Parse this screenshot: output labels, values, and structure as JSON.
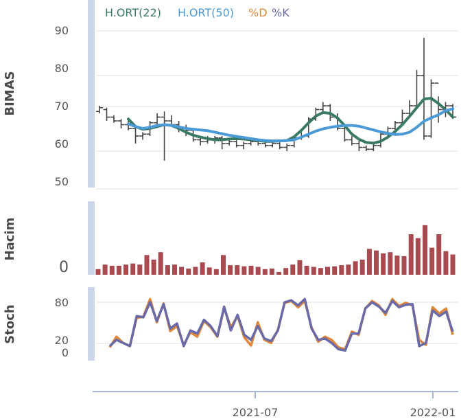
{
  "chart_data": [
    {
      "type": "line",
      "panel": "price",
      "ylabel": "BIMAS",
      "yticks": [
        50,
        60,
        70,
        80,
        90
      ],
      "ylim": [
        48,
        98
      ],
      "legend": [
        {
          "label": "H.ORT(22)",
          "color": "#3a7a64"
        },
        {
          "label": "H.ORT(50)",
          "color": "#4a9ad8"
        },
        {
          "label": "%D",
          "color": "#e0883a"
        },
        {
          "label": "%K",
          "color": "#6a6aa8"
        }
      ],
      "legend_position": "top-left",
      "ohlc_color": "#444444",
      "ohlc": [
        [
          68.5,
          70,
          68,
          69.5
        ],
        [
          69,
          69.5,
          66,
          67
        ],
        [
          67,
          67.5,
          65.5,
          66
        ],
        [
          66,
          66.5,
          64,
          65
        ],
        [
          65,
          66,
          63.5,
          64
        ],
        [
          64,
          64.5,
          60,
          62
        ],
        [
          62,
          63,
          61,
          62.5
        ],
        [
          62.5,
          66,
          62,
          65.5
        ],
        [
          65.5,
          68,
          65,
          67
        ],
        [
          67,
          68.5,
          55.5,
          66
        ],
        [
          66,
          67.5,
          64.5,
          65
        ],
        [
          65,
          66,
          63,
          64
        ],
        [
          64,
          65,
          62,
          63.5
        ],
        [
          63.5,
          64,
          60.5,
          61
        ],
        [
          61,
          62,
          59.5,
          60.5
        ],
        [
          60.5,
          62,
          60,
          61
        ],
        [
          61,
          62,
          60,
          61.5
        ],
        [
          61.5,
          62,
          58.5,
          60
        ],
        [
          60,
          61,
          59.5,
          60.5
        ],
        [
          60.5,
          61,
          59,
          59.5
        ],
        [
          59.5,
          60.5,
          58.5,
          60
        ],
        [
          60,
          61,
          59.5,
          60.5
        ],
        [
          60.5,
          61,
          59.5,
          60
        ],
        [
          60,
          60.5,
          59,
          59.5
        ],
        [
          59.5,
          60.5,
          59,
          60
        ],
        [
          60,
          60.5,
          58.5,
          59
        ],
        [
          59,
          60,
          58,
          59.5
        ],
        [
          59.5,
          62,
          59,
          61.5
        ],
        [
          61.5,
          63,
          61,
          62
        ],
        [
          62,
          67,
          61.5,
          66.5
        ],
        [
          66.5,
          69.5,
          66,
          69
        ],
        [
          69,
          71,
          68,
          70
        ],
        [
          70,
          70.5,
          66,
          67
        ],
        [
          67,
          68,
          63.5,
          64
        ],
        [
          64,
          65,
          60.5,
          61
        ],
        [
          61,
          62,
          59.5,
          60
        ],
        [
          60,
          61.5,
          58,
          59
        ],
        [
          59,
          59.5,
          58,
          58.5
        ],
        [
          58.5,
          60,
          58,
          59.5
        ],
        [
          59.5,
          63,
          59,
          62.5
        ],
        [
          62.5,
          64.5,
          62,
          64
        ],
        [
          64,
          66,
          63.5,
          65.5
        ],
        [
          65.5,
          69,
          65,
          68
        ],
        [
          68,
          71.5,
          67.5,
          70
        ],
        [
          70,
          79.5,
          69.5,
          78
        ],
        [
          78,
          88,
          61,
          62
        ],
        [
          62,
          77,
          61.5,
          76
        ],
        [
          76,
          72.5,
          65.5,
          69
        ],
        [
          69,
          71,
          67,
          70
        ],
        [
          70,
          70.5,
          66.5,
          67
        ]
      ],
      "series": [
        {
          "name": "H.ORT(22)",
          "color": "#3a7a64",
          "values": [
            null,
            null,
            null,
            null,
            66.5,
            64.5,
            63.8,
            64,
            64.5,
            65,
            64.8,
            64,
            63,
            62.2,
            61.7,
            61.3,
            61,
            61,
            61.2,
            61.3,
            61.2,
            61,
            60.8,
            60.6,
            60.6,
            60.7,
            60.8,
            61.8,
            63.5,
            65.5,
            67.3,
            68.2,
            68,
            66.8,
            64.8,
            62.5,
            61.1,
            60.3,
            60.1,
            60.6,
            61.7,
            63.2,
            65,
            67.2,
            69.5,
            71.8,
            72,
            70.6,
            69,
            67
          ]
        },
        {
          "name": "H.ORT(50)",
          "color": "#4a9ad8",
          "values": [
            null,
            null,
            null,
            null,
            65.2,
            64.5,
            64,
            64.3,
            64.8,
            65,
            64.8,
            64.4,
            64,
            63.8,
            63.6,
            63.4,
            63,
            62.6,
            62.2,
            61.9,
            61.6,
            61.3,
            61,
            60.8,
            60.7,
            60.7,
            60.8,
            61,
            61.7,
            62.5,
            63.3,
            63.9,
            64.3,
            64.6,
            64.8,
            64.8,
            64.6,
            64.1,
            63.6,
            63.1,
            62.7,
            62.4,
            62.5,
            63,
            64.3,
            65.9,
            66.8,
            67.6,
            68.7,
            69.2
          ]
        },
        {
          "name": "%D",
          "color": "#e0883a",
          "values": [
            8,
            25,
            15,
            10,
            55,
            57,
            85,
            48,
            78,
            34,
            42,
            12,
            32,
            25,
            50,
            40,
            25,
            71,
            40,
            58,
            24,
            11,
            48,
            20,
            15,
            36,
            79,
            82,
            72,
            82,
            40,
            17,
            25,
            20,
            8,
            5,
            33,
            28,
            70,
            82,
            75,
            60,
            85,
            74,
            79,
            75,
            20,
            12,
            72,
            62,
            70,
            28
          ]
        },
        {
          "name": "%K",
          "color": "#6a6aa8",
          "values": [
            10,
            20,
            15,
            10,
            58,
            56,
            80,
            50,
            77,
            38,
            46,
            10,
            35,
            30,
            52,
            42,
            26,
            73,
            35,
            60,
            28,
            20,
            42,
            22,
            18,
            35,
            80,
            83,
            75,
            85,
            38,
            20,
            22,
            15,
            5,
            3,
            30,
            30,
            70,
            80,
            73,
            63,
            82,
            72,
            76,
            77,
            10,
            15,
            67,
            58,
            65,
            33
          ]
        }
      ]
    },
    {
      "type": "bar",
      "panel": "volume",
      "ylabel": "Hacim",
      "yticks": [
        0
      ],
      "ylim": [
        0,
        100
      ],
      "bar_color": "#a84a50",
      "values": [
        10,
        18,
        16,
        16,
        18,
        20,
        18,
        35,
        27,
        40,
        17,
        18,
        14,
        11,
        14,
        22,
        13,
        10,
        35,
        17,
        17,
        15,
        16,
        14,
        10,
        11,
        5,
        12,
        18,
        26,
        16,
        14,
        12,
        14,
        15,
        17,
        18,
        24,
        27,
        46,
        43,
        38,
        40,
        34,
        33,
        72,
        65,
        88,
        48,
        72,
        42,
        36
      ]
    },
    {
      "type": "line",
      "panel": "stoch",
      "ylabel": "Stoch",
      "yticks": [
        80,
        20,
        0
      ],
      "ylim": [
        -5,
        95
      ]
    }
  ],
  "xaxis": {
    "ticks": [
      "2021-07",
      "2022-01"
    ]
  }
}
